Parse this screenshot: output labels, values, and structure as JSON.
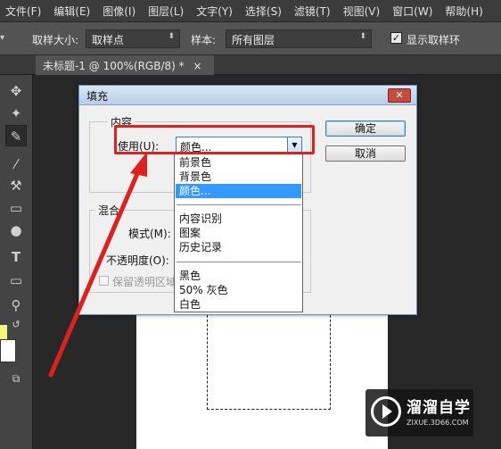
{
  "menubar": {
    "items": [
      "文件(F)",
      "编辑(E)",
      "图像(I)",
      "图层(L)",
      "文字(Y)",
      "选择(S)",
      "滤镜(T)",
      "视图(V)",
      "窗口(W)",
      "帮助(H)"
    ]
  },
  "options_bar": {
    "sample_size_label": "取样大小:",
    "sample_size_value": "取样点",
    "sample_label": "样本:",
    "sample_value": "所有图层",
    "show_ring_label": "显示取样环",
    "show_ring_checked": true
  },
  "document_tab": {
    "title": "未标题-1 @ 100%(RGB/8) *",
    "close_glyph": "×"
  },
  "toolbox": {
    "tool_icons": [
      "move-tool",
      "magic-wand-tool",
      "eyedropper-tool",
      "brush-tool",
      "clone-stamp-tool",
      "eraser-tool",
      "burn-tool",
      "text-tool",
      "rectangle-tool",
      "zoom-tool",
      "swap-colors",
      "quick-mask",
      "screen-mode"
    ],
    "foreground_color": "#f5f57a",
    "background_color": "#ffffff"
  },
  "fill_dialog": {
    "title": "填充",
    "close_glyph": "✕",
    "content_group": "内容",
    "use_label": "使用(U):",
    "use_value": "颜色...",
    "ok_label": "确定",
    "cancel_label": "取消",
    "blend_group": "混合",
    "mode_label": "模式(M):",
    "opacity_label": "不透明度(O):",
    "preserve_transparency_label": "保留透明区域"
  },
  "dropdown": {
    "groups": [
      [
        "前景色",
        "背景色",
        "颜色..."
      ],
      [
        "内容识别",
        "图案",
        "历史记录"
      ],
      [
        "黑色",
        "50% 灰色",
        "白色"
      ]
    ],
    "selected": "颜色..."
  },
  "annotation": {
    "highlight_color": "#e0201c"
  },
  "watermark": {
    "title": "溜溜自学",
    "subtitle": "ZIXUE.3D66.COM"
  }
}
